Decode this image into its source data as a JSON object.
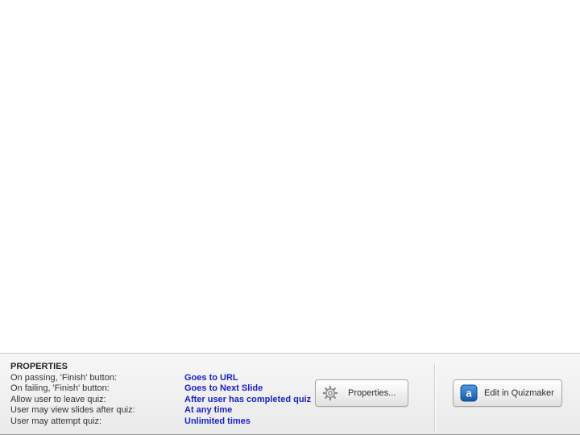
{
  "properties": {
    "title": "PROPERTIES",
    "rows": [
      {
        "label": "On passing, 'Finish' button:",
        "value": "Goes to URL"
      },
      {
        "label": "On failing, 'Finish' button:",
        "value": "Goes to Next Slide"
      },
      {
        "label": "Allow user to leave quiz:",
        "value": "After user has completed quiz"
      },
      {
        "label": "User may view slides after quiz:",
        "value": "At any time"
      },
      {
        "label": "User may attempt quiz:",
        "value": "Unlimited times"
      }
    ]
  },
  "buttons": {
    "properties_label": "Properties...",
    "edit_label": "Edit in Quizmaker",
    "properties_icon": "gear-icon",
    "edit_icon": "quizmaker-app-icon"
  },
  "colors": {
    "value_text": "#1b22c8",
    "app_icon": "#1f6fc1"
  }
}
